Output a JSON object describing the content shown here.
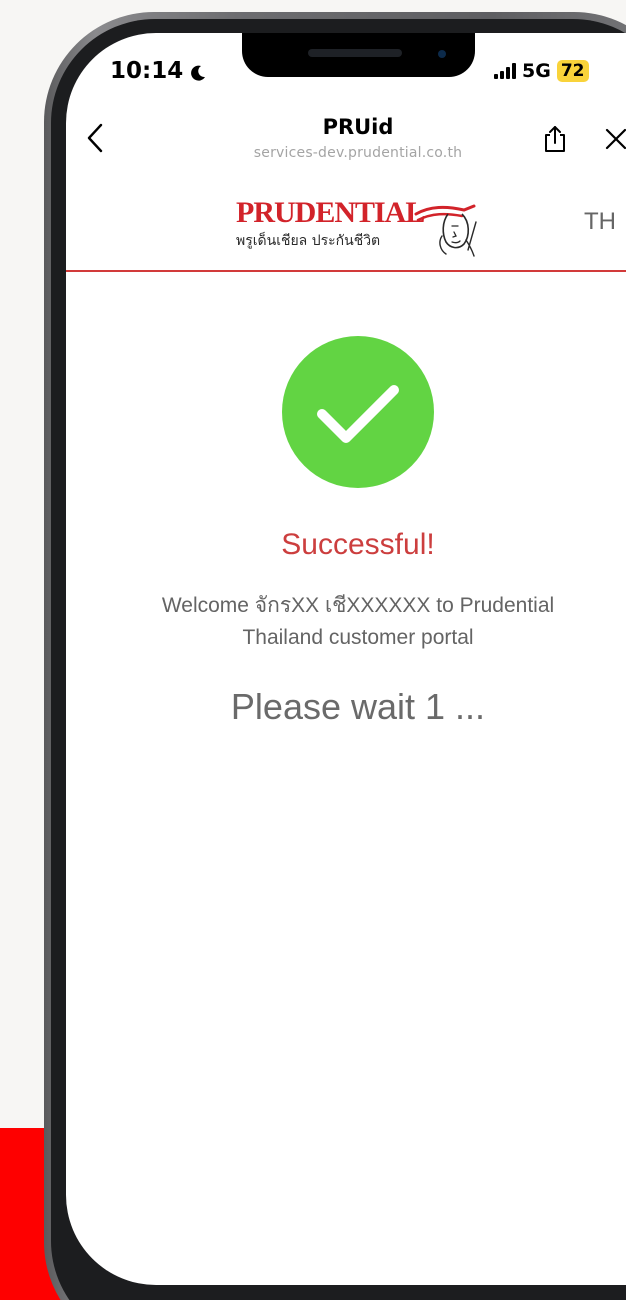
{
  "status_bar": {
    "time": "10:14",
    "network": "5G",
    "battery": "72"
  },
  "browser_bar": {
    "title": "PRUid",
    "url": "services-dev.prudential.co.th"
  },
  "header": {
    "brand_name": "PRUDENTIAL",
    "brand_thai": "พรูเด็นเชียล ประกันชีวิต",
    "language": "TH"
  },
  "main": {
    "title": "Successful!",
    "message_line1": "Welcome จักรXX เชีXXXXXX to Prudential",
    "message_line2": "Thailand customer portal",
    "wait_text": "Please wait 1 ..."
  },
  "colors": {
    "brand_red": "#d2232a",
    "success_green": "#62d443",
    "title_red": "#cc3e3e",
    "backdrop_red": "#fe0000"
  }
}
